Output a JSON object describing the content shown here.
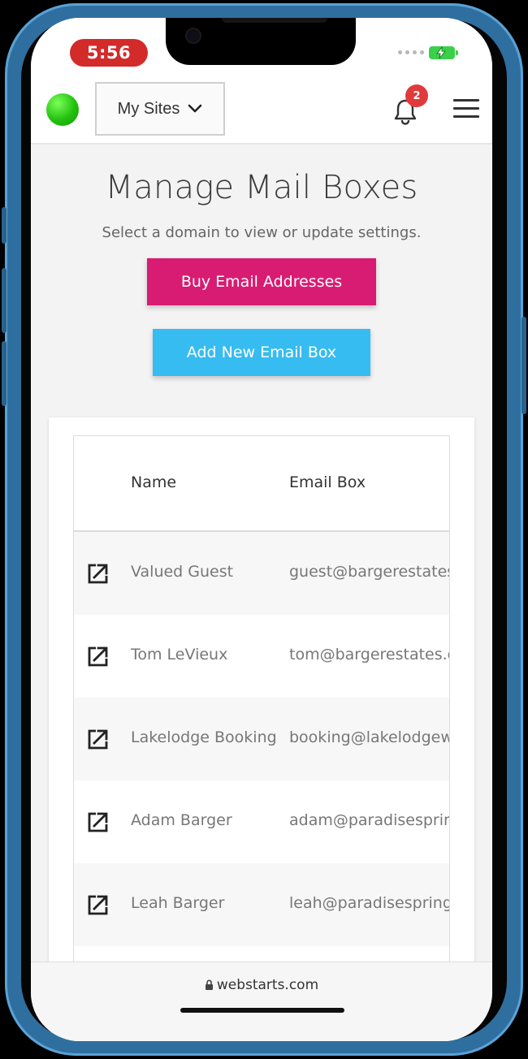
{
  "status_bar": {
    "time": "5:56",
    "colors": {
      "time_pill": "#d32a2a",
      "battery": "#3bd04a"
    }
  },
  "header": {
    "site_selector": "My Sites",
    "notification_count": "2",
    "icons": [
      "logo-dot",
      "chevron-down-icon",
      "bell-icon",
      "hamburger-menu-icon"
    ]
  },
  "main": {
    "title": "Manage Mail Boxes",
    "subtitle": "Select a domain to view or update settings.",
    "buy_button": "Buy Email Addresses",
    "add_button": "Add New Email Box",
    "colors": {
      "buy": "#d81c73",
      "add": "#36bcf0"
    }
  },
  "table": {
    "columns": [
      "Name",
      "Email Box"
    ],
    "rows": [
      {
        "name": "Valued Guest",
        "email": "guest@bargerestates."
      },
      {
        "name": "Tom LeVieux",
        "email": "tom@bargerestates.c"
      },
      {
        "name": "Lakelodge Booking",
        "email": "booking@lakelodgewe"
      },
      {
        "name": "Adam Barger",
        "email": "adam@paradisespring"
      },
      {
        "name": "Leah Barger",
        "email": "leah@paradisespringw"
      }
    ]
  },
  "browser": {
    "url": "webstarts.com"
  }
}
